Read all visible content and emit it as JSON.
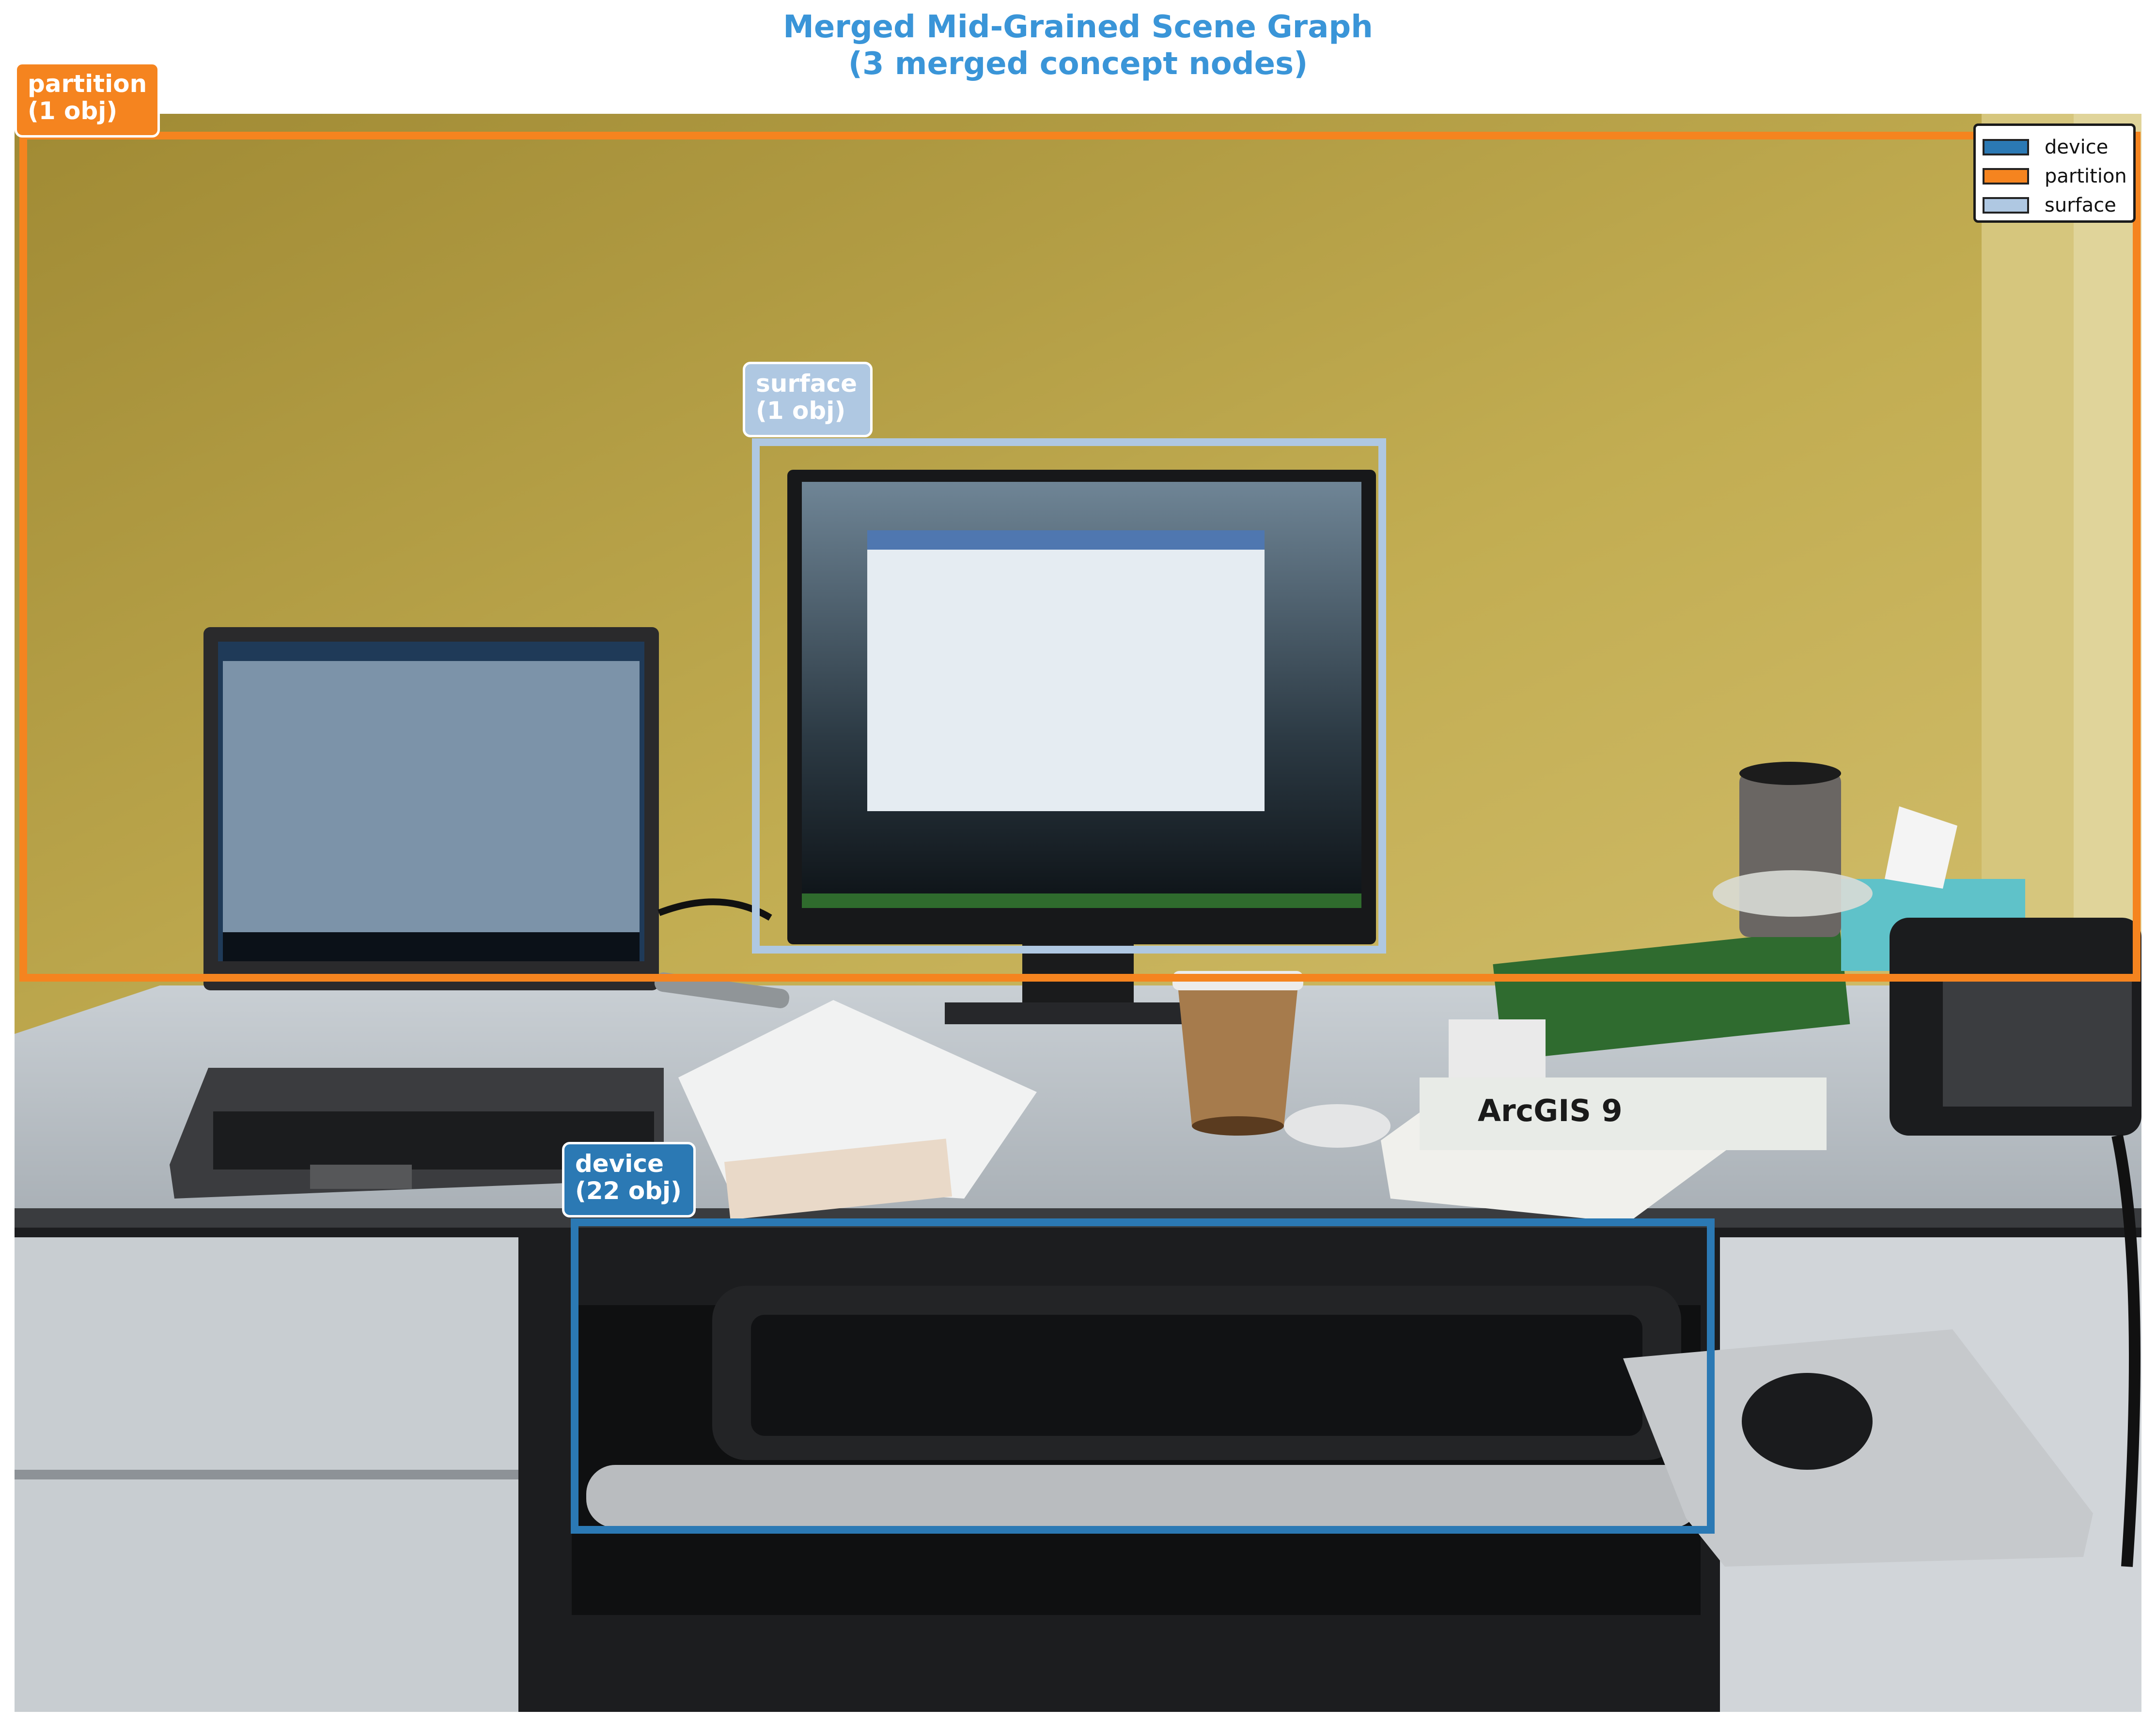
{
  "title": {
    "line1": "Merged Mid-Grained Scene Graph",
    "line2": "(3 merged concept nodes)"
  },
  "colors": {
    "device": "#2b79b4",
    "partition": "#f5841f",
    "surface": "#afc8e2",
    "title": "#3a95d8"
  },
  "regions": {
    "partition": {
      "label": "partition\n(1 obj)"
    },
    "surface": {
      "label": "surface\n(1 obj)"
    },
    "device": {
      "label": "device\n(22 obj)"
    }
  },
  "legend": {
    "items": [
      {
        "name": "device"
      },
      {
        "name": "partition"
      },
      {
        "name": "surface"
      }
    ]
  },
  "photo": {
    "subjects": [
      "laptop-icon",
      "monitor-icon",
      "keyboard-icon",
      "mouse-icon",
      "telephone-icon",
      "coffee-cup-icon",
      "books-icon"
    ]
  }
}
